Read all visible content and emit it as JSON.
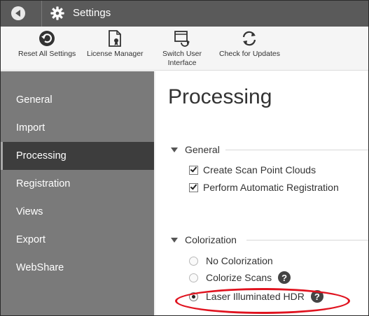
{
  "window": {
    "title": "Settings"
  },
  "icons": {
    "back": "back-arrow-icon",
    "title": "gear-icon"
  },
  "toolbar": {
    "reset": {
      "label": "Reset All Settings",
      "icon": "reset-icon"
    },
    "license": {
      "label": "License Manager",
      "icon": "license-icon"
    },
    "switch": {
      "label1": "Switch User",
      "label2": "Interface",
      "icon": "switch-ui-icon"
    },
    "updates": {
      "label": "Check for Updates",
      "icon": "refresh-icon"
    }
  },
  "sidebar": {
    "items": [
      {
        "label": "General",
        "active": false
      },
      {
        "label": "Import",
        "active": false
      },
      {
        "label": "Processing",
        "active": true
      },
      {
        "label": "Registration",
        "active": false
      },
      {
        "label": "Views",
        "active": false
      },
      {
        "label": "Export",
        "active": false
      },
      {
        "label": "WebShare",
        "active": false
      }
    ]
  },
  "main": {
    "title": "Processing",
    "general": {
      "header": "General",
      "options": [
        {
          "label": "Create Scan Point Clouds",
          "checked": true
        },
        {
          "label": "Perform Automatic Registration",
          "checked": true
        }
      ]
    },
    "colorization": {
      "header": "Colorization",
      "options": [
        {
          "label": "No Colorization",
          "selected": false,
          "help": false
        },
        {
          "label": "Colorize Scans",
          "selected": false,
          "help": true
        },
        {
          "label": "Laser Illuminated HDR",
          "selected": true,
          "help": true
        }
      ],
      "help_glyph": "?"
    }
  },
  "colors": {
    "titlebar": "#5a5a5a",
    "sidebar": "#7a7a7a",
    "sidebar_active": "#3d3d3d",
    "highlight": "#e0131f"
  }
}
